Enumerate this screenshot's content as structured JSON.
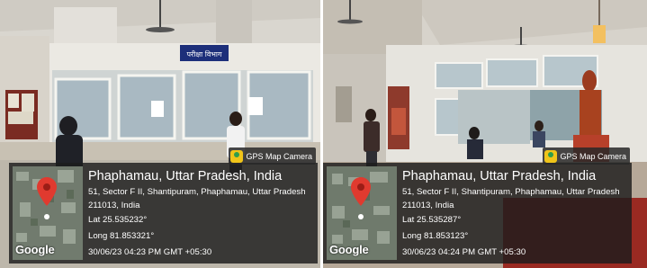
{
  "left": {
    "sign": "परीक्षा विभाग",
    "badge": "GPS Map Camera",
    "place": "Phaphamau, Uttar Pradesh, India",
    "address_line1": "51, Sector F II, Shantipuram, Phaphamau, Uttar Pradesh",
    "address_line2": "211013, India",
    "lat": "Lat 25.535232°",
    "long": "Long 81.853321°",
    "timestamp": "30/06/23 04:23 PM GMT +05:30",
    "map_brand": "Google"
  },
  "right": {
    "badge": "GPS Map Camera",
    "place": "Phaphamau, Uttar Pradesh, India",
    "address_line1": "51, Sector F II, Shantipuram, Phaphamau, Uttar Pradesh",
    "address_line2": "211013, India",
    "lat": "Lat 25.535287°",
    "long": "Long 81.853123°",
    "timestamp": "30/06/23 04:24 PM GMT +05:30",
    "map_brand": "Google"
  }
}
